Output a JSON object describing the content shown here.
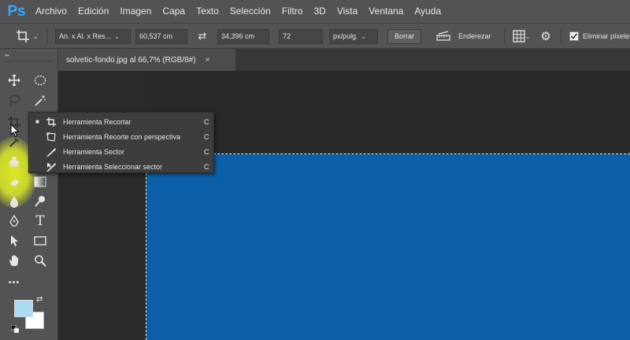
{
  "app": {
    "logo_text": "Ps"
  },
  "menu": [
    "Archivo",
    "Edición",
    "Imagen",
    "Capa",
    "Texto",
    "Selección",
    "Filtro",
    "3D",
    "Vista",
    "Ventana",
    "Ayuda"
  ],
  "options_bar": {
    "ratio_select": "An. x Al. x Res...",
    "width_value": "60,537 cm",
    "height_value": "34,396 cm",
    "resolution_value": "72",
    "resolution_unit": "px/pulg.",
    "clear_button": "Borrar",
    "straighten_label": "Enderezar",
    "delete_cropped_label": "Eliminar píxeles"
  },
  "document_tab": {
    "title": "solvetic-fondo.jpg al 66,7% (RGB/8#)",
    "close_glyph": "×"
  },
  "toolbar": {
    "grip": "••",
    "more_glyph": "•••"
  },
  "flyout": {
    "items": [
      {
        "label": "Herramienta Recortar",
        "key": "C",
        "active": true,
        "icon": "crop-icon"
      },
      {
        "label": "Herramienta Recorte con perspectiva",
        "key": "C",
        "active": false,
        "icon": "perspective-crop-icon"
      },
      {
        "label": "Herramienta Sector",
        "key": "C",
        "active": false,
        "icon": "slice-icon"
      },
      {
        "label": "Herramienta Seleccionar sector",
        "key": "C",
        "active": false,
        "icon": "slice-select-icon"
      }
    ]
  },
  "colors": {
    "foreground": "#a9dcf3",
    "background": "#ffffff",
    "canvas_blue": "#0a5fa6",
    "highlight": "#e6f01e"
  }
}
